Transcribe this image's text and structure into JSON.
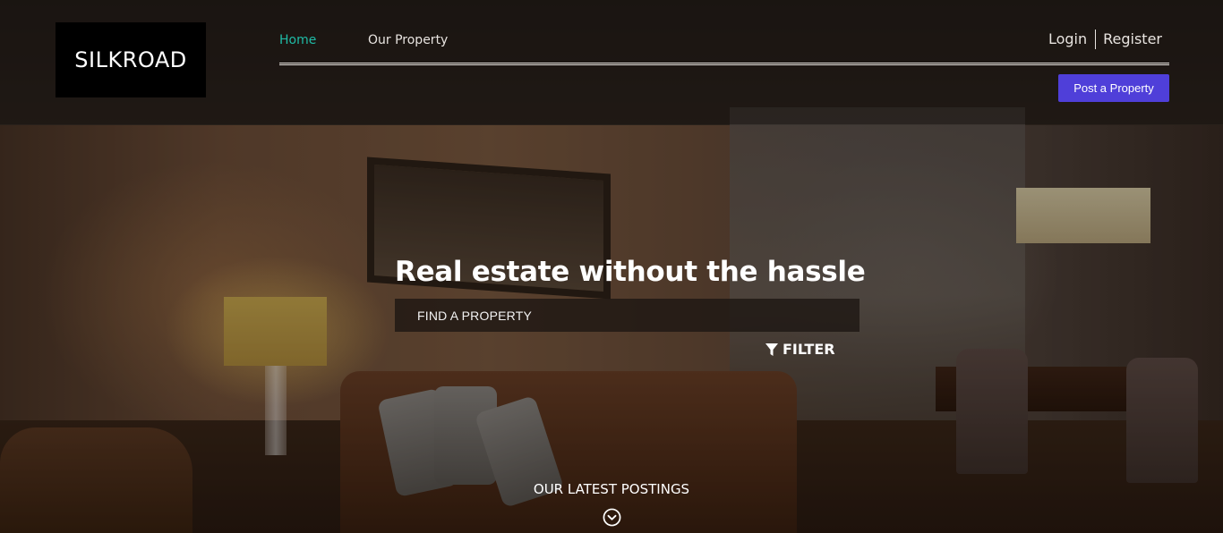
{
  "header": {
    "logo_text": "SILKROAD",
    "nav": [
      {
        "label": "Home",
        "active": true
      },
      {
        "label": "Our Property",
        "active": false
      }
    ],
    "login_label": "Login",
    "register_label": "Register",
    "post_button_label": "Post a Property"
  },
  "hero": {
    "headline": "Real estate without the hassle",
    "search_placeholder": "FIND A PROPERTY",
    "filter_label": "FILTER",
    "latest_label": "OUR LATEST POSTINGS"
  },
  "colors": {
    "accent_active_nav": "#1fbba6",
    "post_button": "#4f3fd9"
  },
  "icons": {
    "filter": "filter-icon",
    "scroll": "chevron-down-circle-icon"
  }
}
